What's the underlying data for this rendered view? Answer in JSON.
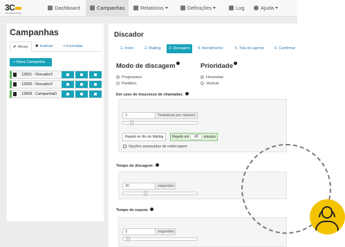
{
  "brand": {
    "logo_text": "3C",
    "logo_subtext": "3CPLUS TECNOLOGIA"
  },
  "navbar": {
    "items": [
      {
        "label": "Dashboard",
        "icon": "home-icon",
        "dropdown": false
      },
      {
        "label": "Campanhas",
        "icon": "list-icon",
        "dropdown": false,
        "active": true
      },
      {
        "label": "Relatórios",
        "icon": "table-icon",
        "dropdown": true
      },
      {
        "label": "Definições",
        "icon": "wrench-icon",
        "dropdown": true
      },
      {
        "label": "Log",
        "icon": "document-icon",
        "dropdown": false
      },
      {
        "label": "Ajuda",
        "icon": "question-icon",
        "dropdown": true
      }
    ]
  },
  "campaigns_panel": {
    "title": "Campanhas",
    "tabs": [
      {
        "label": "Ativas",
        "icon": "check-icon",
        "active": true
      },
      {
        "label": "Inativas",
        "icon": "times-icon"
      },
      {
        "label": "Excluídas",
        "icon": "trash-icon"
      }
    ],
    "new_button": "+ Nova Campanha",
    "campaigns": [
      {
        "name": "12831 - Discador3"
      },
      {
        "name": "12830 - Discador2"
      },
      {
        "name": "12828 - CampanhaD"
      }
    ]
  },
  "discador": {
    "title": "Discador",
    "steps": [
      {
        "label": "1. Início"
      },
      {
        "label": "2. Mailing"
      },
      {
        "label": "3. Discagem",
        "active": true
      },
      {
        "label": "4. Atendimento"
      },
      {
        "label": "5. Tela do agente"
      },
      {
        "label": "6. Confirmar"
      }
    ],
    "modo": {
      "title": "Modo de discagem",
      "options": [
        {
          "label": "Progressivo",
          "selected": true
        },
        {
          "label": "Preditivo",
          "selected": false
        }
      ]
    },
    "prioridade": {
      "title": "Prioridade",
      "options": [
        {
          "label": "Horizontal",
          "selected": true
        },
        {
          "label": "Vertical",
          "selected": false
        }
      ]
    },
    "insucesso": {
      "label": "Em caso de insucesso de chamadas:",
      "attempts_value": "2",
      "attempts_unit": "Tentativas por número",
      "attempts_level": 0.1,
      "repeat_mailing_button": "Repetir no fim do Mailing",
      "repeat_in_prefix": "Repetir em",
      "repeat_in_value": "45",
      "repeat_in_unit": "minutos",
      "advanced_checkbox": "Opções avançadas de rediscagem"
    },
    "tempo_discagem": {
      "label": "Tempo de discagem:",
      "value": "30",
      "unit": "segundos",
      "level": 0.3
    },
    "tempo_espera": {
      "label": "Tempo de espera:",
      "value": "3",
      "unit": "segundos",
      "level": 0.05
    }
  }
}
